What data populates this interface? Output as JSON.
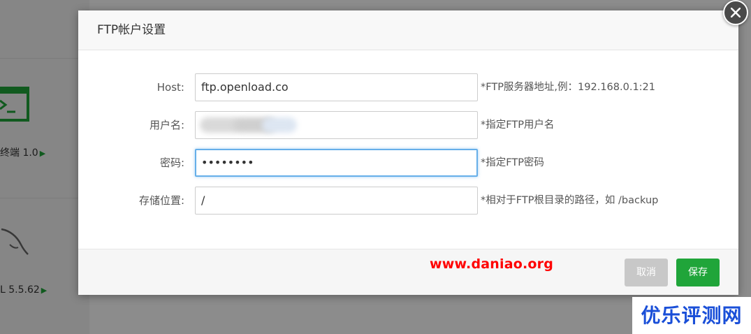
{
  "background": {
    "terminal_label": "终端 1.0",
    "mysql_label": "L 5.5.62"
  },
  "modal": {
    "title": "FTP帐户设置",
    "fields": [
      {
        "label": "Host:",
        "value": "ftp.openload.co",
        "hint": "*FTP服务器地址,例：192.168.0.1:21"
      },
      {
        "label": "用户名:",
        "value": "",
        "hint": "*指定FTP用户名"
      },
      {
        "label": "密码:",
        "value": "••••••••",
        "hint": "*指定FTP密码"
      },
      {
        "label": "存储位置:",
        "value": "/",
        "hint": "*相对于FTP根目录的路径，如 /backup"
      }
    ],
    "cancel_label": "取消",
    "save_label": "保存"
  },
  "watermark": "www.daniao.org",
  "brand_tag": "优乐评测网",
  "colors": {
    "accent_green": "#20a53a",
    "focus_blue": "#66afe9",
    "watermark_red": "#ff0000",
    "brand_blue": "#1a4fd8"
  }
}
